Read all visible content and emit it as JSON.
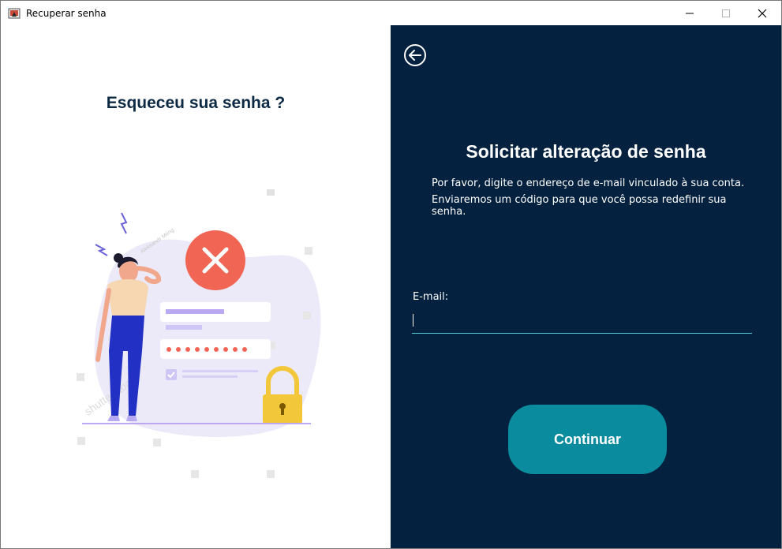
{
  "window": {
    "title": "Recuperar senha"
  },
  "left": {
    "title": "Esqueceu sua senha ?",
    "illustration_icon": "forgot-password-illustration",
    "watermark_texts": [
      "shutterstock",
      "Aleksandr Meng"
    ]
  },
  "right": {
    "back_icon": "arrow-left-circle-icon",
    "title": "Solicitar alteração de senha",
    "description_line1": "Por favor, digite o endereço de e-mail vinculado à sua conta.",
    "description_line2": "Enviaremos um código para que você possa redefinir sua senha.",
    "email_label": "E-mail:",
    "email_value": "",
    "continue_label": "Continuar"
  },
  "colors": {
    "panel_bg": "#04223f",
    "accent": "#0a8b9e",
    "input_underline": "#4fd0d8",
    "title_dark": "#0d2a45",
    "error_red": "#f06553",
    "purple": "#b9a8f2"
  }
}
